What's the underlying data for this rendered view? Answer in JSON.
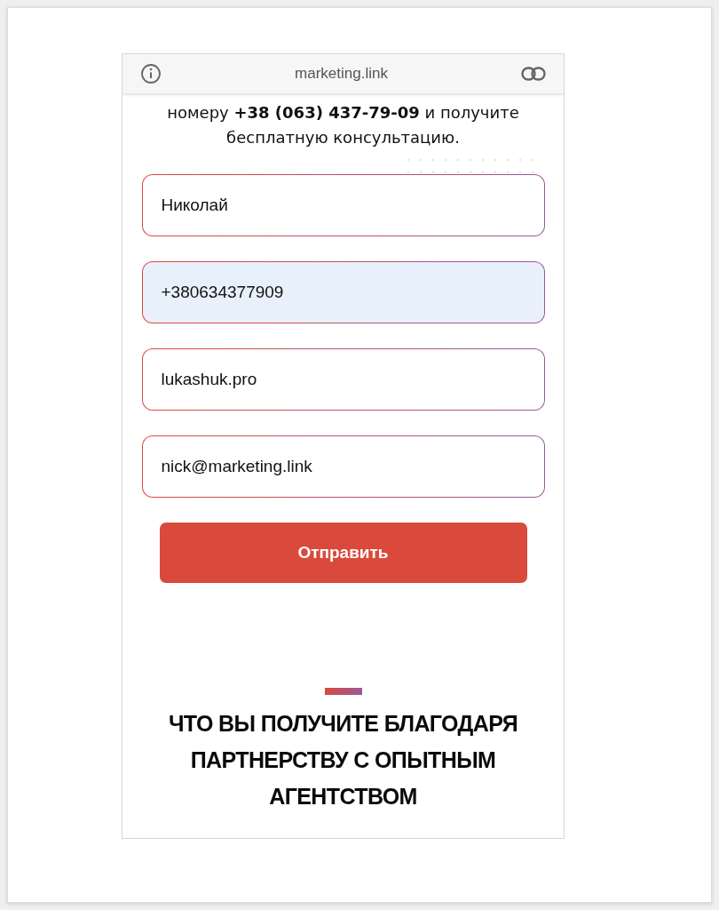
{
  "browser_bar": {
    "url": "marketing.link"
  },
  "intro": "номеру **+38 (063) 437-79-09** и получите бесплатную консультацию.",
  "fields": [
    {
      "value": "Николай",
      "autofilled": false
    },
    {
      "value": "+380634377909",
      "autofilled": true
    },
    {
      "value": "lukashuk.pro",
      "autofilled": false
    },
    {
      "value": "nick@marketing.link",
      "autofilled": false
    }
  ],
  "submit_button": "Отправить",
  "section_heading": "ЧТО ВЫ ПОЛУЧИТЕ БЛАГОДАРЯ ПАРТНЕРСТВУ С ОПЫТНЫМ АГЕНТСТВОМ"
}
